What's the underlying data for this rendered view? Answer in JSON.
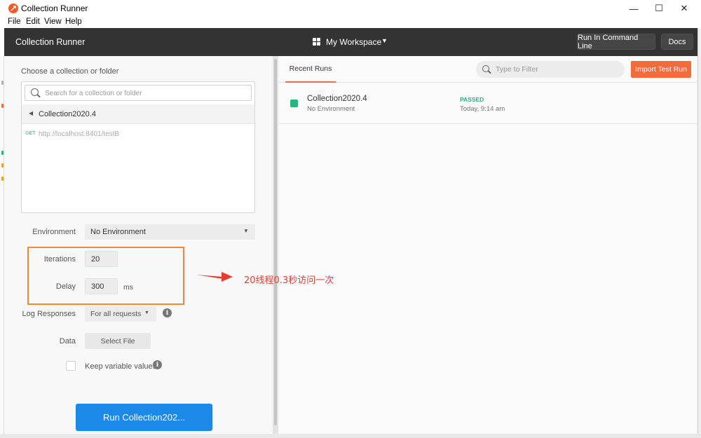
{
  "window": {
    "title": "Collection Runner",
    "controls": [
      "—",
      "☐",
      "✕"
    ]
  },
  "menu": [
    "File",
    "Edit",
    "View",
    "Help"
  ],
  "header": {
    "title": "Collection Runner",
    "workspace": "My Workspace",
    "buttons": {
      "run_cli": "Run In Command Line",
      "docs": "Docs"
    }
  },
  "left": {
    "choose_label": "Choose a collection or folder",
    "search_placeholder": "Search for a collection or folder",
    "collection_name": "Collection2020.4",
    "request": {
      "method": "GET",
      "url": "http://localhost:8401/testB"
    },
    "environment": {
      "label": "Environment",
      "value": "No Environment"
    },
    "iterations": {
      "label": "Iterations",
      "value": "20"
    },
    "delay": {
      "label": "Delay",
      "value": "300",
      "unit": "ms"
    },
    "log_responses": {
      "label": "Log Responses",
      "value": "For all requests"
    },
    "data": {
      "label": "Data",
      "button": "Select File"
    },
    "keep_variables": {
      "label": "Keep variable values",
      "checked": false
    },
    "run_button": "Run Collection202..."
  },
  "right": {
    "tab": "Recent Runs",
    "filter_placeholder": "Type to Filter",
    "import_button": "Import Test Run",
    "runs": [
      {
        "name": "Collection2020.4",
        "environment": "No Environment",
        "result": "PASSED",
        "time": "Today, 9:14 am"
      }
    ]
  },
  "annotation": "20线程0.3秒访问一次",
  "colors": {
    "accent_orange": "#f26b3a",
    "run_blue": "#1c89e8",
    "passed_green": "#26b47f",
    "header_dark": "#333333",
    "annotation_red": "#e53d2f"
  },
  "icons": [
    "postman-logo-icon",
    "grid-icon",
    "caret-down-icon",
    "search-icon",
    "caret-left-icon",
    "info-icon",
    "filter-search-icon",
    "status-square-icon",
    "arrow-icon"
  ]
}
